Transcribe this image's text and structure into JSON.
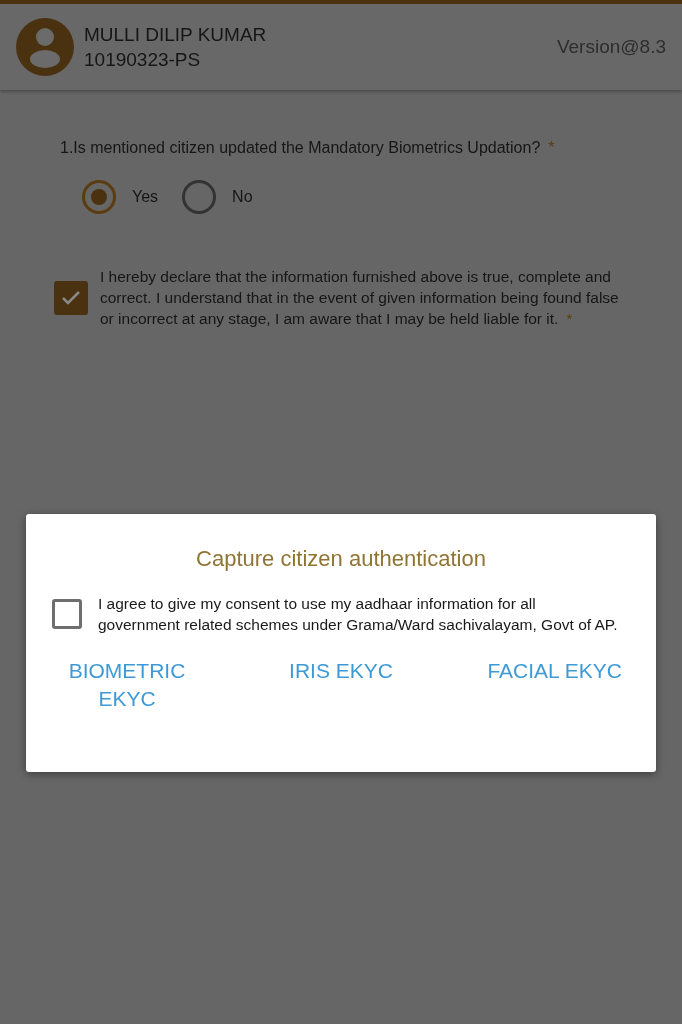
{
  "header": {
    "name": "MULLI DILIP KUMAR",
    "id": "10190323-PS",
    "version": "Version@8.3"
  },
  "question": {
    "text": "1.Is mentioned citizen updated the Mandatory Biometrics Updation?",
    "required_mark": "*",
    "options": [
      {
        "label": "Yes",
        "selected": true
      },
      {
        "label": "No",
        "selected": false
      }
    ]
  },
  "declaration": {
    "text": "I hereby declare that the information furnished above is true, complete and correct. I understand that in the event of given information being found false or incorrect at any stage, I am aware that I may be held liable for it.",
    "required_mark": "*",
    "checked": true
  },
  "dialog": {
    "title": "Capture citizen authentication",
    "consent": {
      "text": "I agree to give my consent to use my aadhaar information for all government related schemes under Grama/Ward sachivalayam, Govt of AP.",
      "checked": false
    },
    "buttons": [
      "BIOMETRIC EKYC",
      "IRIS EKYC",
      "FACIAL EKYC"
    ]
  }
}
